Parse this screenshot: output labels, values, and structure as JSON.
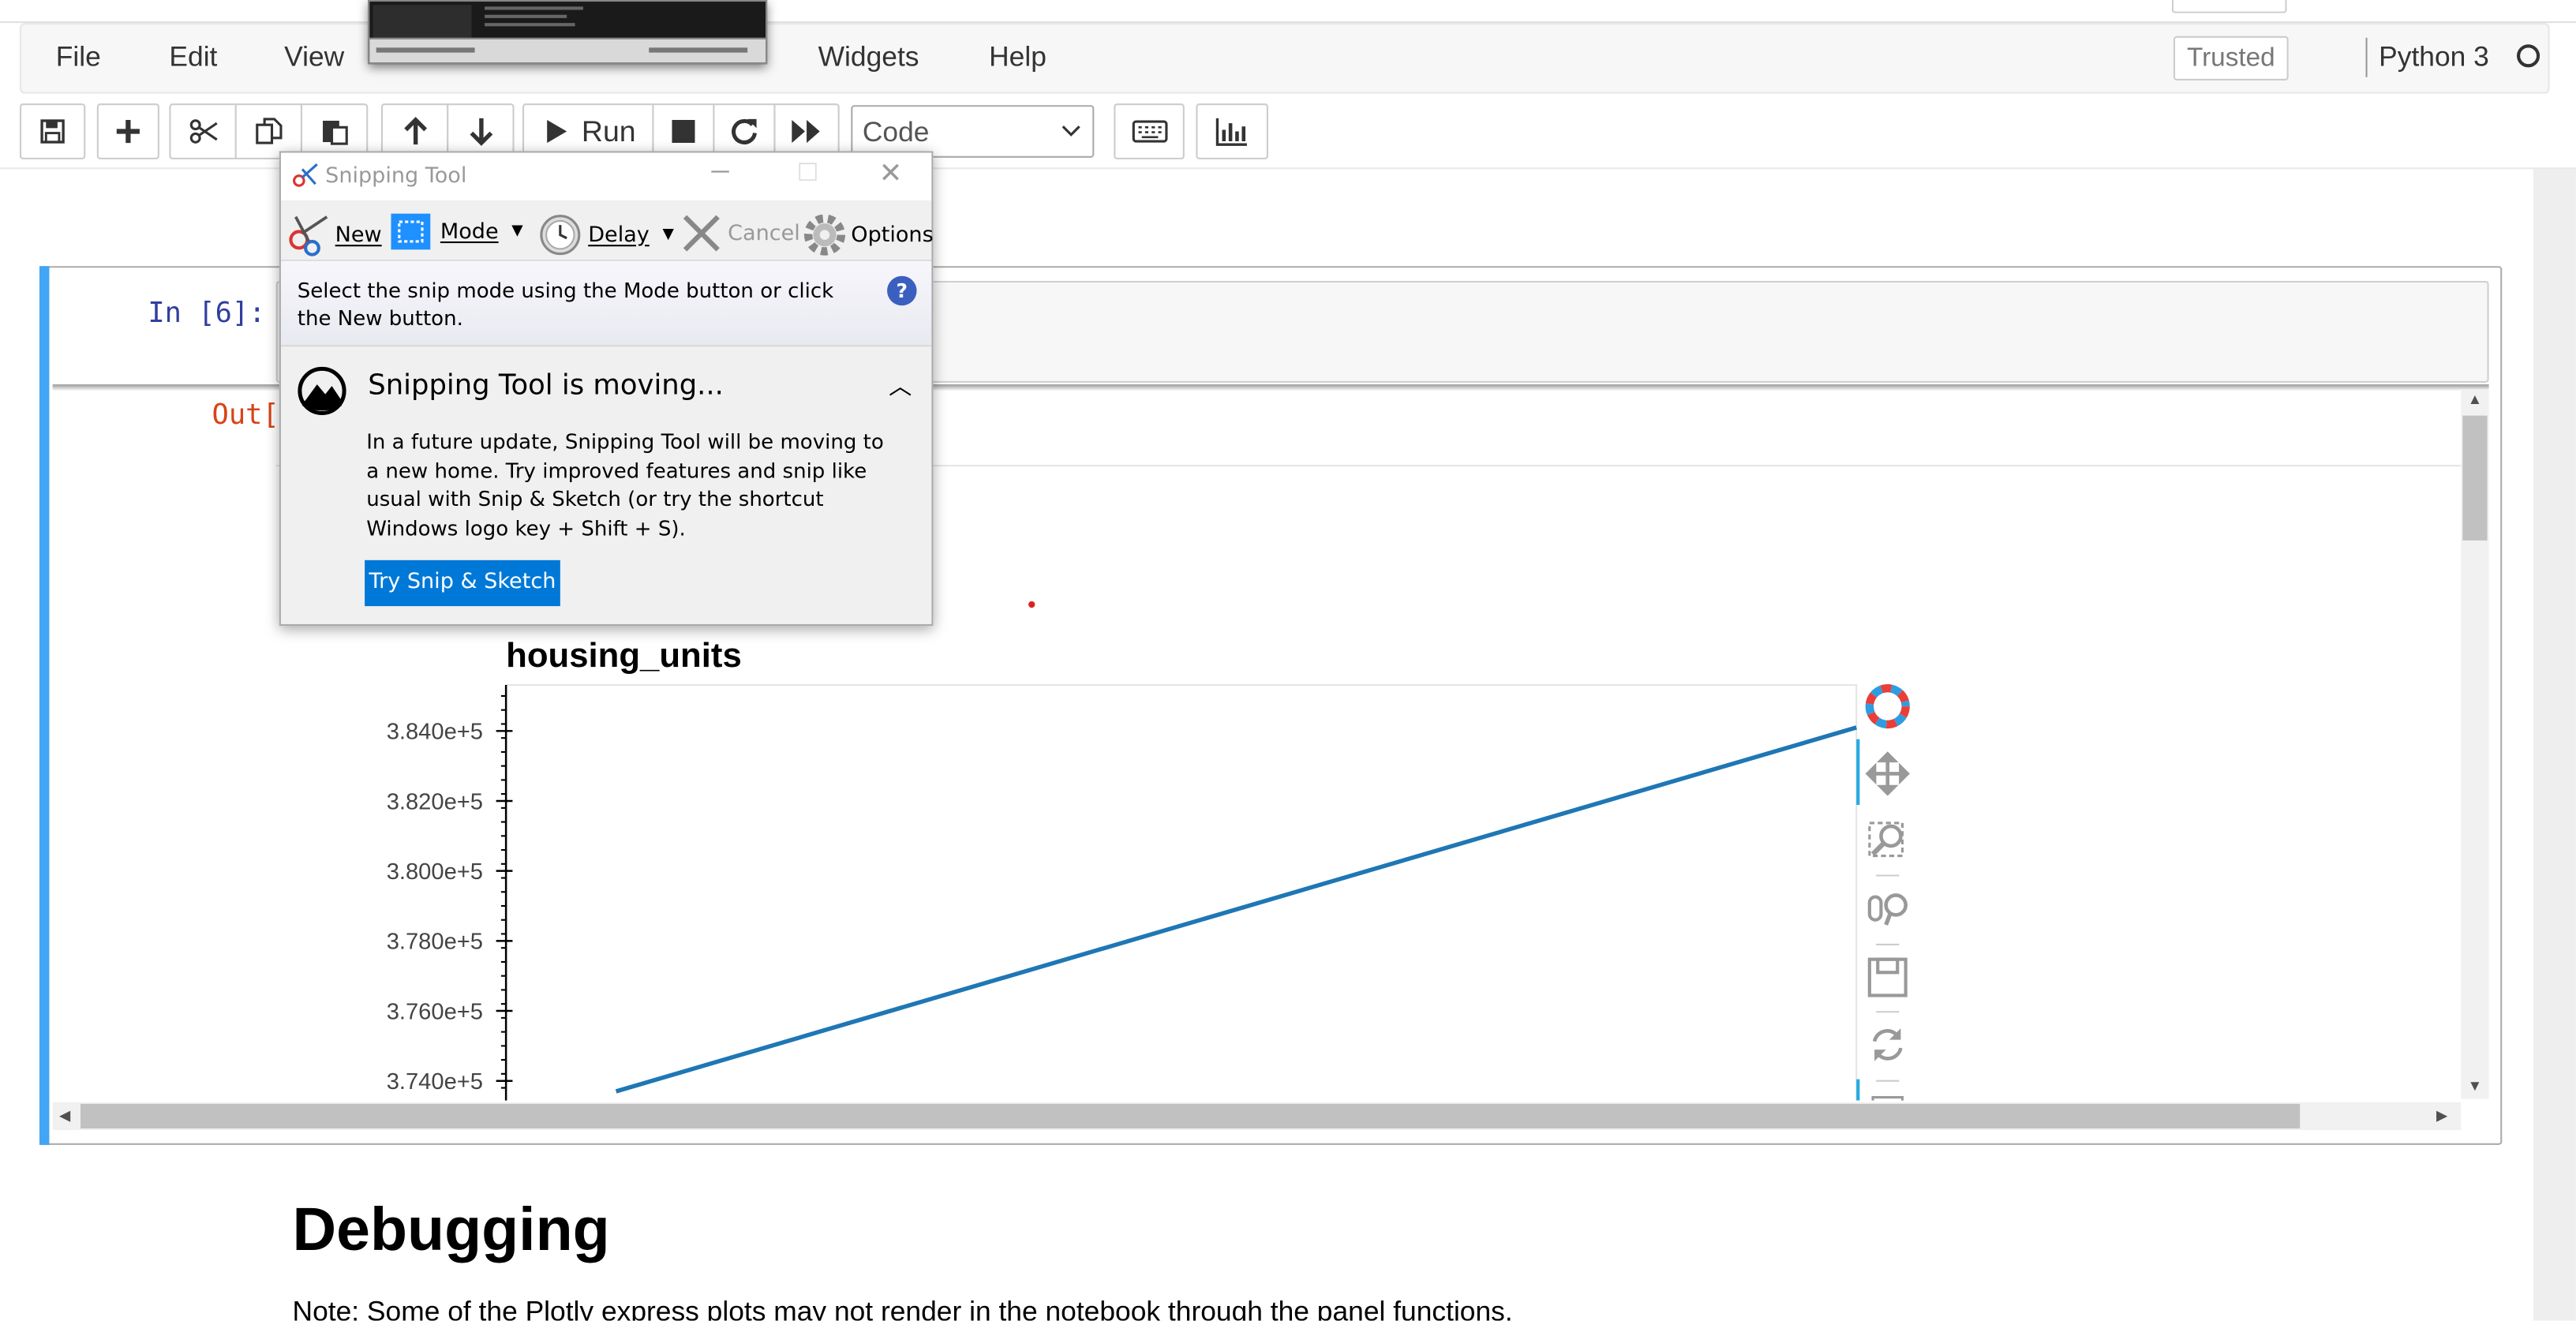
{
  "menu": {
    "items": [
      "File",
      "Edit",
      "View",
      "Widgets",
      "Help"
    ],
    "trusted_label": "Trusted",
    "kernel_name": "Python 3"
  },
  "toolbar": {
    "run_label": "Run",
    "cell_type": "Code"
  },
  "cell": {
    "in_prompt": "In [6]:",
    "out_prompt": "Out["
  },
  "chart_data": {
    "type": "line",
    "title": "housing_units",
    "ytick_labels": [
      "3.840e+5",
      "3.820e+5",
      "3.800e+5",
      "3.780e+5",
      "3.760e+5",
      "3.740e+5"
    ],
    "yticks": [
      384000,
      382000,
      380000,
      378000,
      376000,
      374000
    ],
    "ylim": [
      373800,
      385100
    ],
    "x": [
      0,
      1
    ],
    "series": [
      {
        "values": [
          373700,
          384100
        ],
        "color": "#1f77b4"
      }
    ],
    "accent_dot_color": "#e02020",
    "toolbar_icons": [
      "bokeh-logo-icon",
      "pan-icon",
      "box-zoom-icon",
      "wheel-zoom-icon",
      "save-icon",
      "reset-icon"
    ]
  },
  "snipping_tool": {
    "title": "Snipping Tool",
    "new_label": "New",
    "mode_label": "Mode",
    "delay_label": "Delay",
    "cancel_label": "Cancel",
    "options_label": "Options",
    "hint": "Select the snip mode using the Mode button or click the New button.",
    "moving_header": "Snipping Tool is moving...",
    "moving_body": "In a future update, Snipping Tool will be moving to a new home. Try improved features and snip like usual with Snip & Sketch (or try the shortcut Windows logo key + Shift + S).",
    "try_button": "Try Snip & Sketch"
  },
  "markdown": {
    "heading": "Debugging",
    "note": "Note: Some of the Plotly express plots may not render in the notebook through the panel functions."
  }
}
